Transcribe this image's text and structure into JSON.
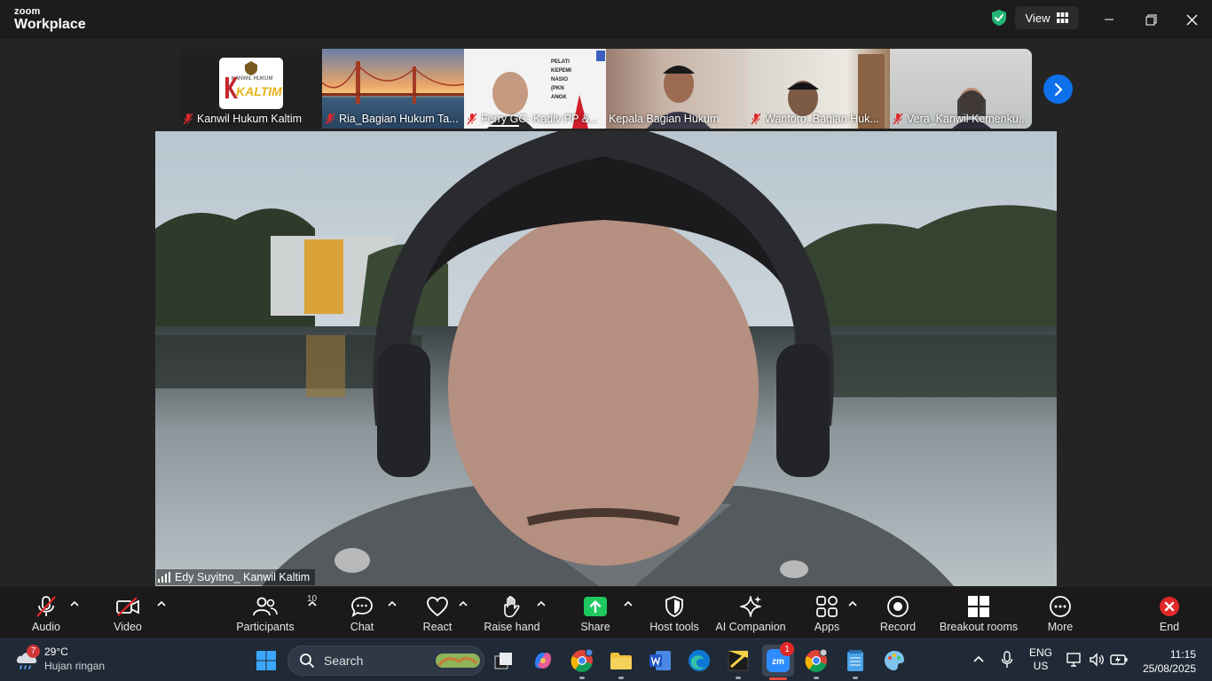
{
  "titlebar": {
    "brand_top": "zoom",
    "brand_bottom": "Workplace",
    "view_label": "View"
  },
  "thumbnails": [
    {
      "name": "Kanwil Hukum Kaltim",
      "logo_line1": "KANWIL HUKUM",
      "logo_line2": "KALTIM"
    },
    {
      "name": "Ria_Bagian Hukum Ta..."
    },
    {
      "name": "Ferry GC- Kadiv PP &...",
      "slide_text": "PELATI KEPEMI NASIO (PKN ANGK"
    },
    {
      "name": "Kepala Bagian Hukum"
    },
    {
      "name": "Wantoro_Bagian Huk..."
    },
    {
      "name": "Vera_Kanwil Kemenku..."
    }
  ],
  "main": {
    "speaker_name": "Edy Suyitno_ Kanwil Kaltim"
  },
  "toolbar": {
    "audio": "Audio",
    "video": "Video",
    "participants": "Participants",
    "participants_count": "10",
    "chat": "Chat",
    "react": "React",
    "raise_hand": "Raise hand",
    "share": "Share",
    "host_tools": "Host tools",
    "ai_companion": "AI Companion",
    "apps": "Apps",
    "record": "Record",
    "breakout_rooms": "Breakout rooms",
    "more": "More",
    "end": "End"
  },
  "taskbar": {
    "weather_badge": "7",
    "temperature": "29°C",
    "condition": "Hujan ringan",
    "search_label": "Search",
    "zoom_badge": "1",
    "lang_top": "ENG",
    "lang_bottom": "US",
    "time": "11:15",
    "date": "25/08/2025"
  },
  "colors": {
    "accent_blue": "#0e71eb",
    "share_green": "#1ec95f",
    "end_red": "#e02828",
    "mute_red": "#e02828"
  }
}
